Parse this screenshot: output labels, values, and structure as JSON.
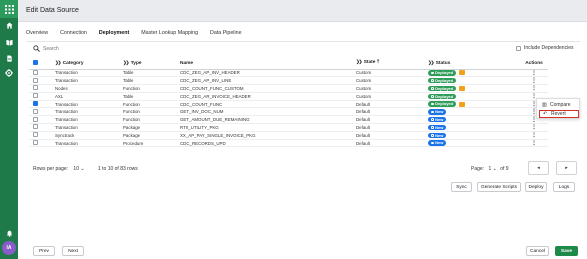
{
  "window": {
    "title": "Edit Data Source"
  },
  "rail": {
    "icons": [
      "apps-grid-icon",
      "home-icon",
      "book-icon",
      "document-icon",
      "settings-gear-icon",
      "notifications-bell-icon"
    ],
    "avatar": "IA"
  },
  "tabs": [
    "Overview",
    "Connection",
    "Deployment",
    "Master Lookup Mapping",
    "Data Pipeline"
  ],
  "active_tab": "Deployment",
  "search": {
    "placeholder": "Search"
  },
  "include_dependencies": {
    "label": "Include Dependencies",
    "checked": false
  },
  "table": {
    "columns": {
      "category": "Category",
      "type": "Type",
      "name": "Name",
      "state": "State",
      "status": "Status",
      "actions": "Actions"
    },
    "rows": [
      {
        "checked": false,
        "category": "Transaction",
        "type": "Table",
        "name": "CDC_ZEG_AP_INV_HEADER",
        "state": "Custom",
        "status": "Deployed",
        "warning": true
      },
      {
        "checked": false,
        "category": "Transaction",
        "type": "Table",
        "name": "CDC_ZEG_AP_INV_LINE",
        "state": "Custom",
        "status": "Deployed",
        "warning": false
      },
      {
        "checked": false,
        "category": "Nodes",
        "type": "Function",
        "name": "CDC_COUNT_FUNC_CUSTOM",
        "state": "Custom",
        "status": "Deployed",
        "warning": true
      },
      {
        "checked": false,
        "category": "AXL",
        "type": "Table",
        "name": "CDC_ZEG_AR_INVOICE_HEADER",
        "state": "Custom",
        "status": "Deployed",
        "warning": false
      },
      {
        "checked": true,
        "category": "Transaction",
        "type": "Function",
        "name": "CDC_COUNT_FUNC",
        "state": "Default",
        "status": "Deployed",
        "warning": true
      },
      {
        "checked": false,
        "category": "Transaction",
        "type": "Function",
        "name": "GET_INV_DOC_NUM",
        "state": "Default",
        "status": "New",
        "warning": false
      },
      {
        "checked": false,
        "category": "Transaction",
        "type": "Function",
        "name": "GET_AMOUNT_DUE_REMAINING",
        "state": "Default",
        "status": "New",
        "warning": false
      },
      {
        "checked": false,
        "category": "Transaction",
        "type": "Package",
        "name": "RTII_UTILITY_PKG",
        "state": "Default",
        "status": "New",
        "warning": false
      },
      {
        "checked": false,
        "category": "Synctrack",
        "type": "Package",
        "name": "XX_AP_PAY_SINGLE_INVOICE_PKG",
        "state": "Default",
        "status": "New",
        "warning": false
      },
      {
        "checked": false,
        "category": "Transaction",
        "type": "Procedure",
        "name": "CDC_RECORDS_UPD",
        "state": "Default",
        "status": "New",
        "warning": false
      }
    ]
  },
  "row_menu": {
    "items": [
      {
        "label": "Compare",
        "icon": "compare-icon"
      },
      {
        "label": "Revert",
        "icon": "revert-icon"
      }
    ]
  },
  "pagination": {
    "rows_per_page_label": "Rows per page:",
    "rows_per_page": "10",
    "range": "1 to 10 of 83 rows",
    "page_label": "Page:",
    "page": "1",
    "page_of": "of 9"
  },
  "actions": {
    "sync": "Sync",
    "generate_scripts": "Generate Scripts",
    "deploy": "Deploy",
    "logs": "Logs"
  },
  "footer": {
    "prev": "Prev",
    "next": "Next",
    "cancel": "Cancel",
    "save": "Save"
  },
  "colors": {
    "rail": "#1f7a4a",
    "deployed": "#2f9e5a",
    "new": "#1a73e8",
    "warning": "#f2a21a",
    "save": "#1e8a4a"
  }
}
